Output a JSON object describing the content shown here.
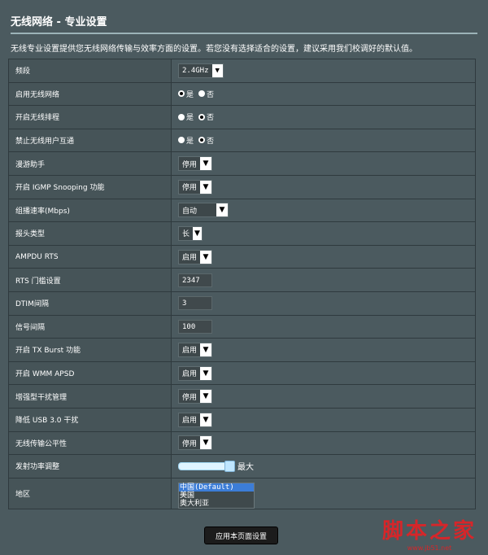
{
  "page": {
    "title": "无线网络 - 专业设置",
    "description": "无线专业设置提供您无线网络传输与效率方面的设置。若您没有选择适合的设置，建议采用我们校调好的默认值。"
  },
  "rows": [
    {
      "label": "频段",
      "type": "select",
      "value": "2.4GHz",
      "mono": true
    },
    {
      "label": "启用无线网络",
      "type": "radio",
      "options": [
        "是",
        "否"
      ],
      "selected": 0
    },
    {
      "label": "开启无线排程",
      "type": "radio",
      "options": [
        "是",
        "否"
      ],
      "selected": 1
    },
    {
      "label": "禁止无线用户互通",
      "type": "radio",
      "options": [
        "是",
        "否"
      ],
      "selected": 1
    },
    {
      "label": "漫游助手",
      "type": "select",
      "value": "停用"
    },
    {
      "label": "开启 IGMP Snooping 功能",
      "type": "select",
      "value": "停用"
    },
    {
      "label": "组播速率(Mbps)",
      "type": "select",
      "value": "自动",
      "wide": true
    },
    {
      "label": "报头类型",
      "type": "select",
      "value": "长"
    },
    {
      "label": "AMPDU RTS",
      "type": "select",
      "value": "启用"
    },
    {
      "label": "RTS 门槛设置",
      "type": "text",
      "value": "2347"
    },
    {
      "label": "DTIM间隔",
      "type": "text",
      "value": "3"
    },
    {
      "label": "信号间隔",
      "type": "text",
      "value": "100"
    },
    {
      "label": "开启 TX Burst 功能",
      "type": "select",
      "value": "启用"
    },
    {
      "label": "开启 WMM APSD",
      "type": "select",
      "value": "启用"
    },
    {
      "label": "增强型干扰管理",
      "type": "select",
      "value": "停用"
    },
    {
      "label": "降低 USB 3.0 干扰",
      "type": "select",
      "value": "启用"
    },
    {
      "label": "无线传输公平性",
      "type": "select",
      "value": "停用"
    },
    {
      "label": "发射功率调整",
      "type": "slider",
      "value_label": "最大",
      "level": 1.0
    }
  ],
  "region": {
    "label": "地区",
    "options": [
      "中国(Default)",
      "美国",
      "奥大利亚"
    ],
    "selected": 0
  },
  "apply_button": "应用本页面设置",
  "watermark": {
    "text": "脚本之家",
    "url": "www.jb51.net"
  },
  "icons": {
    "dropdown": "chevron-down-icon"
  }
}
